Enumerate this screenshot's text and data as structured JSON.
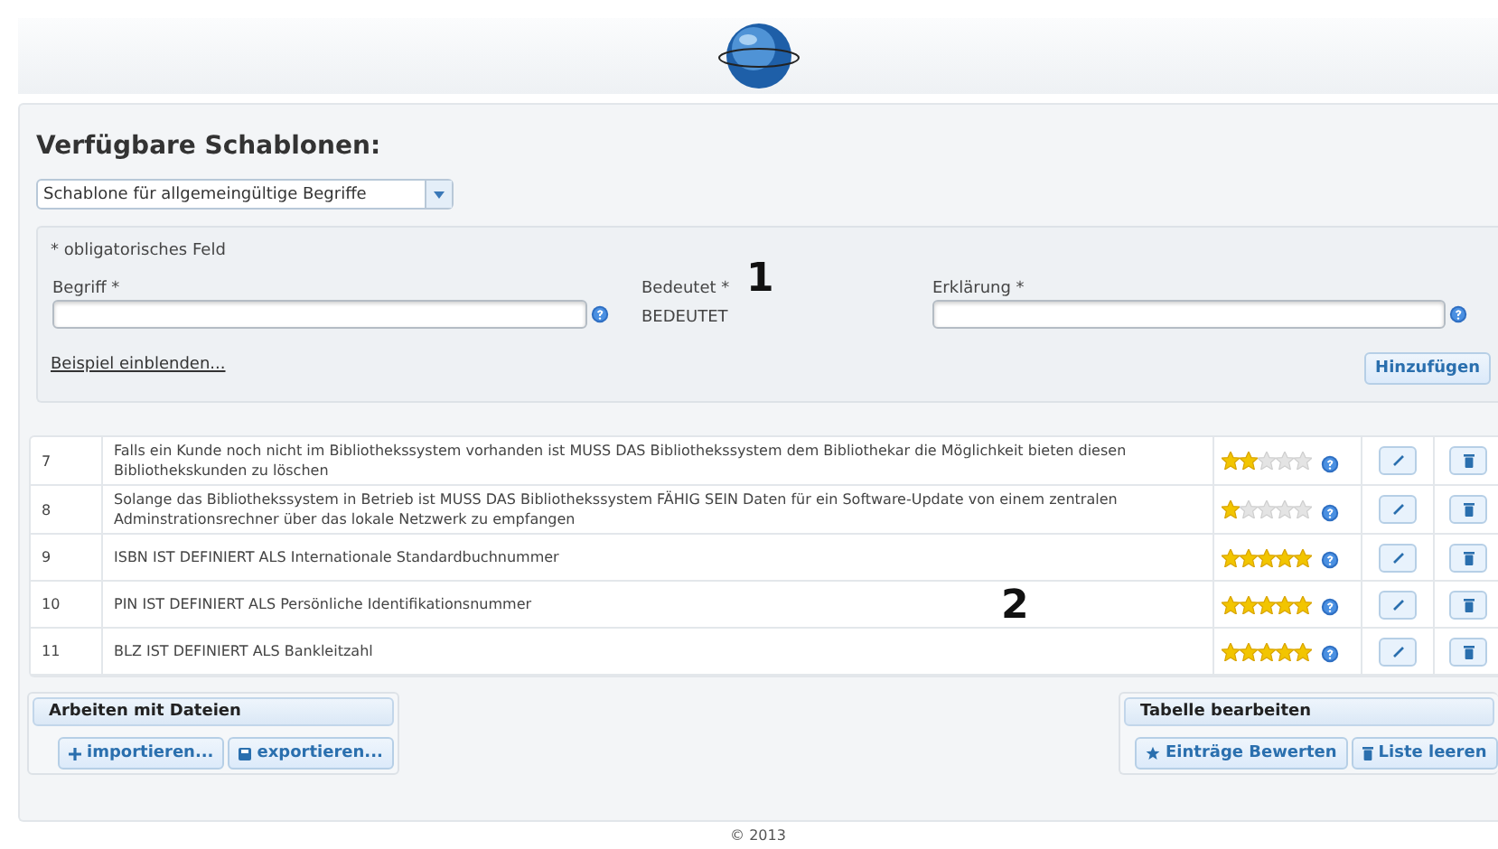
{
  "title": "Verfügbare Schablonen:",
  "template_select": {
    "value": "Schablone für allgemeingültige Begriffe"
  },
  "form": {
    "required_note": "* obligatorisches Feld",
    "term_label": "Begriff *",
    "means_label": "Bedeutet *",
    "means_value": "BEDEUTET",
    "explanation_label": "Erklärung *",
    "example_link": "Beispiel einblenden...",
    "add_button": "Hinzufügen"
  },
  "annotations": [
    "1",
    "2"
  ],
  "rows": [
    {
      "number": "7",
      "text": "Falls ein Kunde noch nicht im Bibliothekssystem vorhanden ist MUSS DAS Bibliothekssystem dem Bibliothekar die Möglichkeit bieten diesen Bibliothekskunden zu löschen",
      "stars": 2
    },
    {
      "number": "8",
      "text": "Solange das Bibliothekssystem in Betrieb ist MUSS DAS Bibliothekssystem FÄHIG SEIN Daten für ein Software-Update von einem zentralen Adminstrationsrechner über das lokale Netzwerk zu empfangen",
      "stars": 1
    },
    {
      "number": "9",
      "text": "ISBN IST DEFINIERT ALS Internationale Standardbuchnummer",
      "stars": 5
    },
    {
      "number": "10",
      "text": "PIN IST DEFINIERT ALS Persönliche Identifikationsnummer",
      "stars": 5
    },
    {
      "number": "11",
      "text": "BLZ IST DEFINIERT ALS Bankleitzahl",
      "stars": 5
    }
  ],
  "file_box": {
    "title": "Arbeiten mit Dateien",
    "buttons": [
      {
        "kind": "import",
        "label": "importieren..."
      },
      {
        "kind": "export",
        "label": "exportieren..."
      }
    ]
  },
  "table_box": {
    "title": "Tabelle bearbeiten",
    "buttons": [
      {
        "kind": "rate",
        "label": "Einträge Bewerten"
      },
      {
        "kind": "clear",
        "label": "Liste leeren"
      }
    ]
  },
  "footer": "© 2013"
}
